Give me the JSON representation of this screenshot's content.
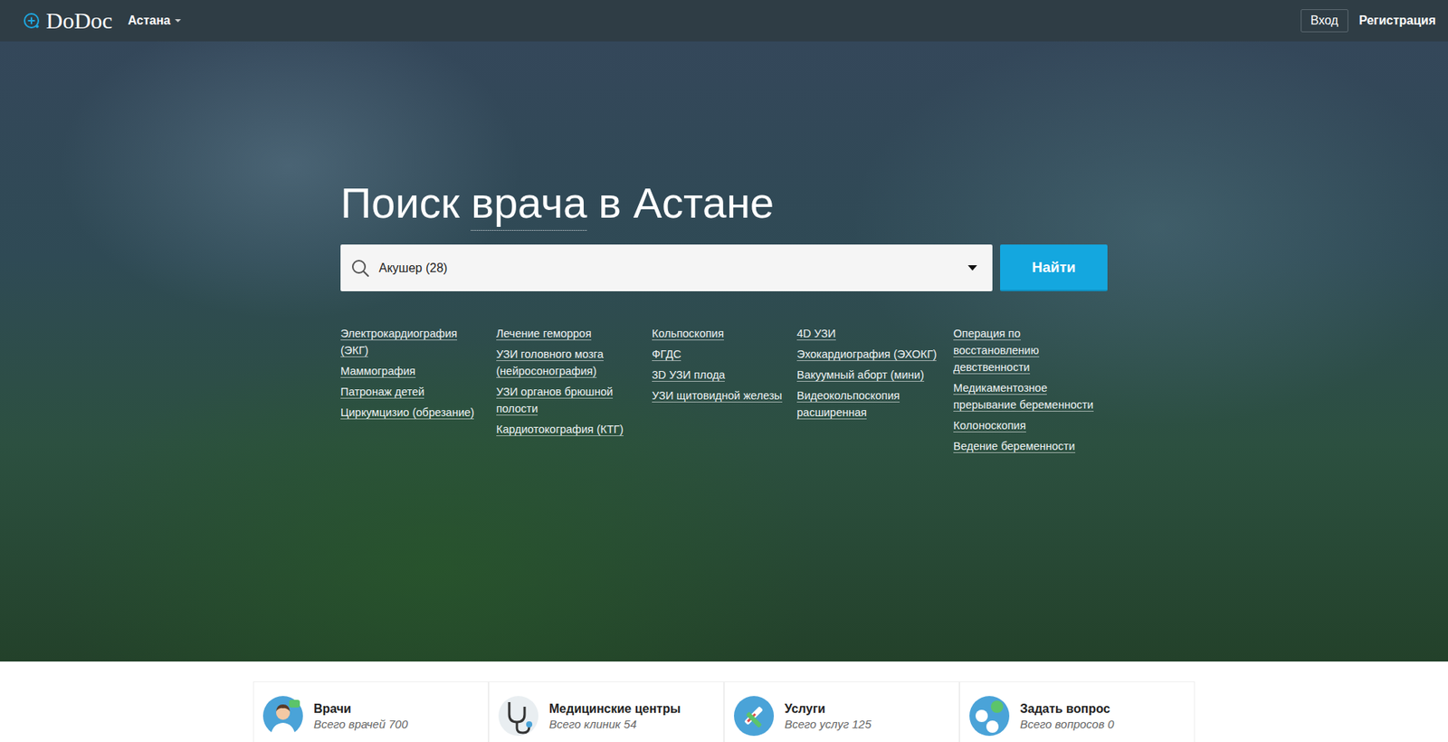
{
  "header": {
    "logo": "DoDoc",
    "city": "Астана",
    "login": "Вход",
    "register": "Регистрация"
  },
  "hero": {
    "title": [
      {
        "text": "Поиск",
        "link": false
      },
      {
        "text": "врача",
        "link": true
      },
      {
        "text": "в Астане",
        "link": false
      }
    ]
  },
  "search": {
    "value": "Акушер (28)",
    "button": "Найти"
  },
  "links": [
    [
      "Электрокардиография (ЭКГ)",
      "Маммография",
      "Патронаж детей",
      "Циркумцизио (обрезание)"
    ],
    [
      "Лечение геморроя",
      "УЗИ головного мозга (нейросонография)",
      "УЗИ органов брюшной полости",
      "Кардиотокография (КТГ)"
    ],
    [
      "Кольпоскопия",
      "ФГДС",
      "3D УЗИ плода",
      "УЗИ щитовидной железы"
    ],
    [
      "4D УЗИ",
      "Эхокардиография (ЭХОКГ)",
      "Вакуумный аборт (мини)",
      "Видеокольпоскопия расширенная"
    ],
    [
      "Операция по восстановлению девственности",
      "Медикаментозное прерывание беременности",
      "Колоноскопия",
      "Ведение беременности"
    ]
  ],
  "stats": [
    {
      "title": "Врачи",
      "count": "Всего врачей 700"
    },
    {
      "title": "Медицинские центры",
      "count": "Всего клиник 54"
    },
    {
      "title": "Услуги",
      "count": "Всего услуг 125"
    },
    {
      "title": "Задать вопрос",
      "count": "Всего вопросов 0"
    }
  ]
}
